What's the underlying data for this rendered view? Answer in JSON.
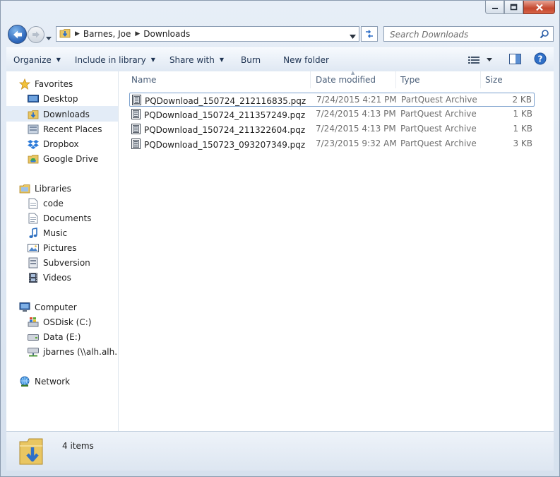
{
  "window": {
    "controls": {
      "minimize": "minimize-icon",
      "maximize": "maximize-icon",
      "close": "close-icon"
    }
  },
  "address": {
    "crumbs": [
      "Barnes, Joe",
      "Downloads"
    ]
  },
  "search": {
    "placeholder": "Search Downloads"
  },
  "toolbar": {
    "organize": "Organize",
    "include_in_library": "Include in library",
    "share_with": "Share with",
    "burn": "Burn",
    "new_folder": "New folder"
  },
  "nav": {
    "favorites": {
      "label": "Favorites",
      "items": [
        "Desktop",
        "Downloads",
        "Recent Places",
        "Dropbox",
        "Google Drive"
      ]
    },
    "libraries": {
      "label": "Libraries",
      "items": [
        "code",
        "Documents",
        "Music",
        "Pictures",
        "Subversion",
        "Videos"
      ]
    },
    "computer": {
      "label": "Computer",
      "items": [
        "OSDisk (C:)",
        "Data (E:)",
        "jbarnes (\\\\alh.alh.me"
      ]
    },
    "network": {
      "label": "Network"
    },
    "selected": "Downloads"
  },
  "columns": {
    "name": "Name",
    "date": "Date modified",
    "type": "Type",
    "size": "Size"
  },
  "files": [
    {
      "name": "PQDownload_150724_212116835.pqz",
      "date": "7/24/2015 4:21 PM",
      "type": "PartQuest Archive",
      "size": "2 KB"
    },
    {
      "name": "PQDownload_150724_211357249.pqz",
      "date": "7/24/2015 4:13 PM",
      "type": "PartQuest Archive",
      "size": "1 KB"
    },
    {
      "name": "PQDownload_150724_211322604.pqz",
      "date": "7/24/2015 4:13 PM",
      "type": "PartQuest Archive",
      "size": "1 KB"
    },
    {
      "name": "PQDownload_150723_093207349.pqz",
      "date": "7/23/2015 9:32 AM",
      "type": "PartQuest Archive",
      "size": "3 KB"
    }
  ],
  "status": {
    "item_count": "4 items"
  },
  "colors": {
    "accent": "#2a63b8",
    "selection": "#e3ecf7",
    "focus_border": "#7da2ce",
    "close_button": "#c4472e"
  }
}
